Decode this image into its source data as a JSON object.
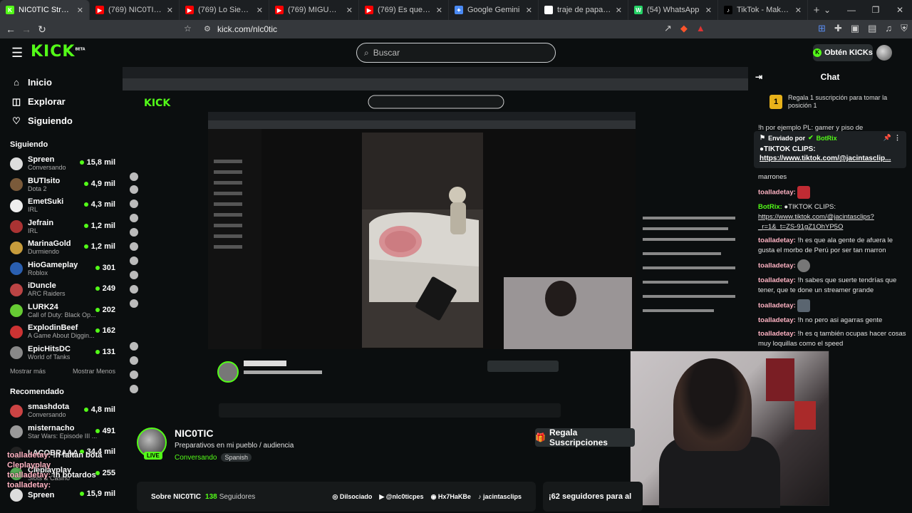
{
  "tabs": [
    {
      "label": "NIC0TIC Stream - V",
      "color": "#53fc18",
      "glyph": "K",
      "active": true
    },
    {
      "label": "(769) NIC0TIC - YouTube",
      "color": "#ff0000",
      "glyph": "▶",
      "active": false
    },
    {
      "label": "(769) Lo Siento BB:/ - Tainy",
      "color": "#ff0000",
      "glyph": "▶",
      "active": false
    },
    {
      "label": "(769) MIGUEL VS 33 MUJE",
      "color": "#ff0000",
      "glyph": "▶",
      "active": false
    },
    {
      "label": "(769) Es que valeria regres",
      "color": "#ff0000",
      "glyph": "▶",
      "active": false
    },
    {
      "label": "Google Gemini",
      "color": "#4a8af4",
      "glyph": "✦",
      "active": false
    },
    {
      "label": "traje de papa noel disfraz",
      "color": "#ffffff",
      "glyph": "G",
      "active": false
    },
    {
      "label": "(54) WhatsApp",
      "color": "#25d366",
      "glyph": "W",
      "active": false
    },
    {
      "label": "TikTok - Make Your Day",
      "color": "#000000",
      "glyph": "♪",
      "active": false
    }
  ],
  "browser": {
    "url": "kick.com/nlc0tic"
  },
  "header": {
    "search_placeholder": "Buscar",
    "obten_label": "Obtén KICKs"
  },
  "sidebar": {
    "nav": [
      {
        "label": "Inicio",
        "icon": "home-icon",
        "glyph": "⌂"
      },
      {
        "label": "Explorar",
        "icon": "compass-icon",
        "glyph": "◫"
      },
      {
        "label": "Siguiendo",
        "icon": "heart-icon",
        "glyph": "♡"
      }
    ],
    "following_title": "Siguiendo",
    "following": [
      {
        "name": "Spreen",
        "category": "Conversando",
        "viewers": "15,8 mil",
        "color": "#ddd"
      },
      {
        "name": "BUTIsito",
        "category": "Dota 2",
        "viewers": "4,9 mil",
        "color": "#7a5a3a"
      },
      {
        "name": "EmetSuki",
        "category": "IRL",
        "viewers": "4,3 mil",
        "color": "#eee"
      },
      {
        "name": "Jefrain",
        "category": "IRL",
        "viewers": "1,2 mil",
        "color": "#a33"
      },
      {
        "name": "MarinaGold",
        "category": "Durmiendo",
        "viewers": "1,2 mil",
        "color": "#c79c3c"
      },
      {
        "name": "HioGameplay",
        "category": "Roblox",
        "viewers": "301",
        "color": "#2a5fb0"
      },
      {
        "name": "iDuncle",
        "category": "ARC Raiders",
        "viewers": "249",
        "color": "#b44"
      },
      {
        "name": "LURK24",
        "category": "Call of Duty: Black Op...",
        "viewers": "202",
        "color": "#6c3"
      },
      {
        "name": "ExplodinBeef",
        "category": "A Game About Diggin...",
        "viewers": "162",
        "color": "#c33"
      },
      {
        "name": "EpicHitsDC",
        "category": "World of Tanks",
        "viewers": "131",
        "color": "#888"
      }
    ],
    "show_more": "Mostrar más",
    "show_less": "Mostrar Menos",
    "recommended_title": "Recomendado",
    "recommended": [
      {
        "name": "smashdota",
        "category": "Conversando",
        "viewers": "4,8 mil",
        "color": "#c44"
      },
      {
        "name": "misternacho",
        "category": "Star Wars: Episode III ...",
        "viewers": "491",
        "color": "#999"
      },
      {
        "name": "LACOBRAAA",
        "category": "",
        "viewers": "34,4 mil",
        "color": "#222"
      },
      {
        "name": "Cleplayplay",
        "category": "Slots & Casino",
        "viewers": "255",
        "color": "#5a5"
      },
      {
        "name": "Spreen",
        "category": "",
        "viewers": "15,9 mil",
        "color": "#ddd"
      }
    ]
  },
  "chat": {
    "title": "Chat",
    "gift_banner_num": "1",
    "gift_banner": "Regala 1 suscripción para tomar la posición 1",
    "top_partial": "!h por ejemplo PL: gamer y piso de",
    "pinned_by": "Enviado por",
    "pinned_bot": "BotRix",
    "pinned_text": "●TIKTOK CLIPS:",
    "pinned_link": "https://www.tiktok.com/@jacintasclip...",
    "messages": [
      {
        "user": "",
        "text": "marrones",
        "emote": ""
      },
      {
        "user": "toalladetay:",
        "text": "",
        "emote": "red"
      },
      {
        "user": "BotRix:",
        "bot": true,
        "text": "●TIKTOK CLIPS: ",
        "link": "https://www.tiktok.com/@jacintasclips?_r=1&_t=ZS-91gZ1OhYP5O",
        "emote": ""
      },
      {
        "user": "toalladetay:",
        "text": "!h es que ala gente de afuera le gusta el morbo de Perú por ser tan marron",
        "emote": ""
      },
      {
        "user": "toalladetay:",
        "text": "",
        "emote": "grey"
      },
      {
        "user": "toalladetay:",
        "text": "!h sabes que suerte tendrías que tener, que te done un streamer grande",
        "emote": ""
      },
      {
        "user": "toalladetay:",
        "text": "",
        "emote": "photo"
      },
      {
        "user": "toalladetay:",
        "text": "!h no pero asi agarras gente",
        "emote": ""
      },
      {
        "user": "toalladetay:",
        "text": "!h es q también ocupas hacer cosas muy loquillas como el speed",
        "emote": ""
      }
    ]
  },
  "stream": {
    "streamer": "NIC0TIC",
    "title": "Preparativos en mi pueblo / audiencia",
    "category": "Conversando",
    "language": "Spanish",
    "live": "LIVE",
    "gift_button": "Regala Suscripciones",
    "about": "Sobre NIC0TIC",
    "followers_count": "138",
    "followers_label": "Seguidores",
    "socials": [
      "Dilsociado",
      "@nlc0ticpes",
      "Hx7HaKBe",
      "jacintasclips"
    ],
    "follow_note": "¡62 seguidores para al"
  },
  "overlay_chat": [
    {
      "user": "toalladetay:",
      "text": "!h faltan bota"
    },
    {
      "user": "Cleplayplay",
      "text": ""
    },
    {
      "user": "toalladetay:",
      "text": "!h botardos"
    },
    {
      "user": "toalladetay:",
      "text": ""
    }
  ]
}
